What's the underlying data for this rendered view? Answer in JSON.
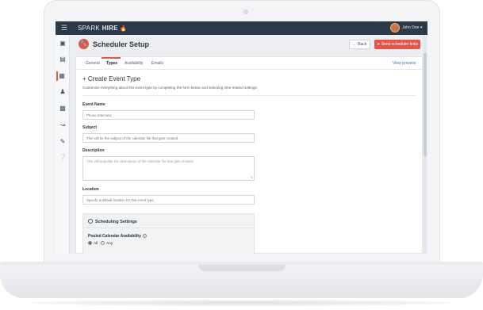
{
  "topbar": {
    "logo_light": "SPARK",
    "logo_bold": "HIRE",
    "user_name": "John Doe"
  },
  "header": {
    "title": "Scheduler Setup",
    "back_label": "Back",
    "send_label": "Send scheduler links"
  },
  "tabs": [
    {
      "label": "General"
    },
    {
      "label": "Types"
    },
    {
      "label": "Availability"
    },
    {
      "label": "Emails"
    }
  ],
  "view_preview": "View preview",
  "section": {
    "title": "Create Event Type",
    "description": "Customize everything about this event type by completing the form below and selecting time-related settings."
  },
  "form": {
    "event_name_label": "Event Name",
    "event_name_placeholder": "Phone Interview",
    "subject_label": "Subject",
    "subject_placeholder": "This will be the subject of the calendar file that gets created",
    "description_label": "Description",
    "description_placeholder": "This will populate the description of the calendar file that gets created",
    "location_label": "Location",
    "location_placeholder": "Specify a default location for this event type"
  },
  "scheduling": {
    "title": "Scheduling Settings",
    "pooled_label": "Pooled Calendar Availability",
    "option_all": "All",
    "option_any": "Any",
    "selected": "All"
  },
  "colors": {
    "accent": "#e2574c",
    "topbar": "#2b3948",
    "link": "#3a74c9"
  }
}
